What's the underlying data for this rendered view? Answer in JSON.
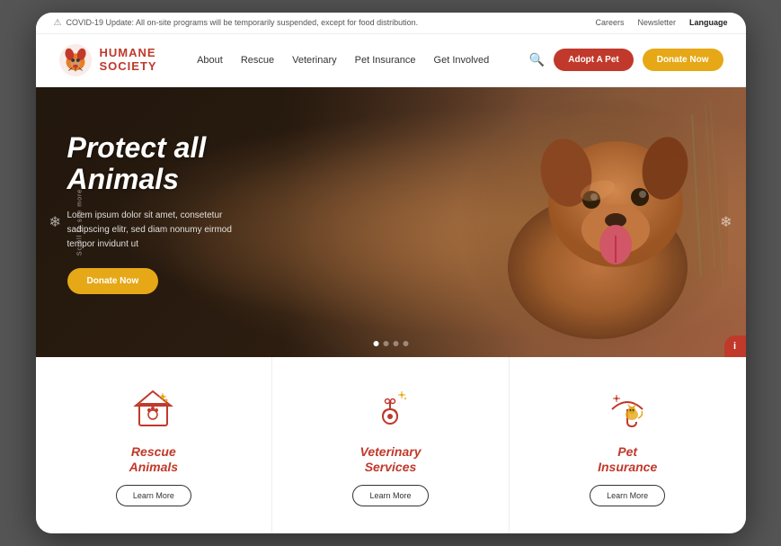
{
  "announcement": {
    "covid_icon": "⚠",
    "text": "COVID-19 Update: All on-site programs will be temporarily suspended, except for food distribution.",
    "links": [
      "Careers",
      "Newsletter",
      "Language"
    ]
  },
  "navbar": {
    "logo_line1": "HUMANE",
    "logo_line2": "SOCIETY",
    "nav_items": [
      "About",
      "Rescue",
      "Veterinary",
      "Pet Insurance",
      "Get Involved"
    ],
    "btn_adopt": "Adopt A Pet",
    "btn_donate": "Donate Now"
  },
  "hero": {
    "title_line1": "Protect all",
    "title_line2": "Animals",
    "subtitle": "Lorem ipsum dolor sit amet, consetetur sadipscing elitr, sed diam nonumy eirmod tempor invidunt ut",
    "btn_donate": "Donate Now",
    "scroll_text": "Scroll to see more",
    "dots_count": 4,
    "active_dot": 0
  },
  "services": [
    {
      "id": "rescue",
      "title_line1": "Rescue",
      "title_line2": "Animals",
      "btn_label": "Learn More"
    },
    {
      "id": "veterinary",
      "title_line1": "Veterinary",
      "title_line2": "Services",
      "btn_label": "Learn More"
    },
    {
      "id": "insurance",
      "title_line1": "Pet",
      "title_line2": "Insurance",
      "btn_label": "Learn More"
    }
  ]
}
